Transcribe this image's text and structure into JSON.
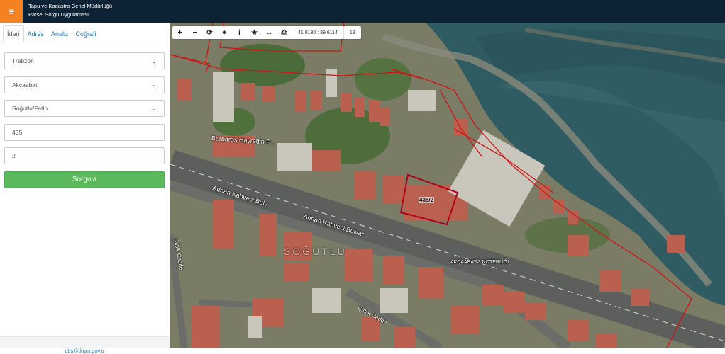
{
  "header": {
    "menu_icon": "≡",
    "title_line1": "Tapu ve Kadastro Genel Müdürlüğü",
    "title_line2": "Parsel Sorgu Uygulaması"
  },
  "sidebar": {
    "tabs": [
      {
        "label": "İdari"
      },
      {
        "label": "Adres"
      },
      {
        "label": "Analiz"
      },
      {
        "label": "Coğrafi"
      }
    ],
    "form": {
      "il": "Trabzon",
      "ilce": "Akçaabat",
      "mahalle": "Soğutlu/Fatih",
      "ada": "435",
      "parsel": "2",
      "submit_label": "Sorgula"
    },
    "footer_email": "cbs@tkgm.gov.tr"
  },
  "map": {
    "toolbar": {
      "zoom_in": "+",
      "zoom_out": "−",
      "refresh": "⟳",
      "locate": "⌖",
      "info": "i",
      "favorite": "★",
      "measure": "↔",
      "print": "⎙"
    },
    "coordinates": "41.0130 : 39.6114",
    "zoom_level": "18",
    "labels": {
      "street1": "Barbaros Hayrettin P...",
      "street2": "Adnan Kahveci Bulv",
      "street3": "Adnan Kahveci Bulvar",
      "street4": "Çiftlik Cadde",
      "street5": "Çiftlik Cadde",
      "district": "SOĞUTLU",
      "poi": "AKÇAABAT 3 NOTERLİĞİ",
      "parcel": "435/2"
    },
    "colors": {
      "sea": "#2c5a63",
      "parcel_outline": "#b3001b",
      "boundary": "#d01515"
    }
  }
}
